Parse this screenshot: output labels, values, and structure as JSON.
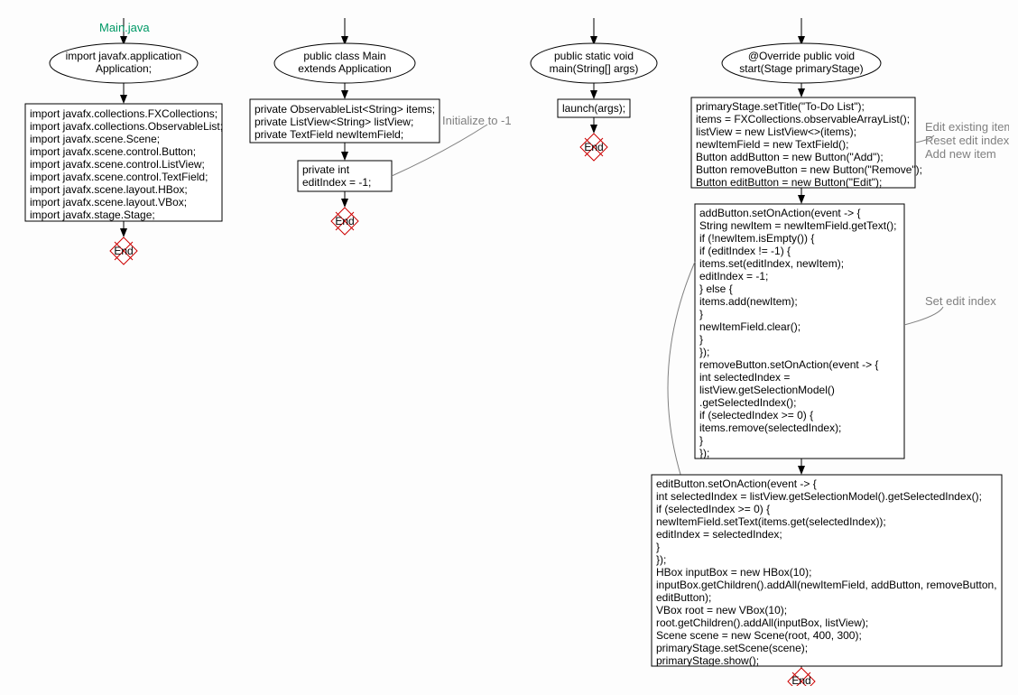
{
  "labels": {
    "main_java": "Main.java",
    "initialize": "Initialize to -1",
    "edit_existing": "Edit existing item",
    "reset_edit": "Reset edit index",
    "add_new": "Add new item",
    "set_edit": "Set edit index"
  },
  "col1": {
    "ellipse": [
      "import javafx.application",
      "Application;"
    ],
    "box": [
      "import javafx.collections.FXCollections;",
      "import javafx.collections.ObservableList;",
      "import javafx.scene.Scene;",
      "import javafx.scene.control.Button;",
      "import javafx.scene.control.ListView;",
      "import javafx.scene.control.TextField;",
      "import javafx.scene.layout.HBox;",
      "import javafx.scene.layout.VBox;",
      "import javafx.stage.Stage;"
    ],
    "end": "End"
  },
  "col2": {
    "ellipse": [
      "public class Main",
      "extends Application"
    ],
    "box1": [
      "private ObservableList<String> items;",
      "private ListView<String> listView;",
      "private TextField newItemField;"
    ],
    "box2": [
      "private int",
      "editIndex = -1;"
    ],
    "end": "End"
  },
  "col3": {
    "ellipse": [
      "public static void",
      "main(String[] args)"
    ],
    "box": [
      "launch(args);"
    ],
    "end": "End"
  },
  "col4": {
    "ellipse": [
      "@Override public void",
      "start(Stage primaryStage)"
    ],
    "box1": [
      "primaryStage.setTitle(\"To-Do List\");",
      "items = FXCollections.observableArrayList();",
      "listView = new ListView<>(items);",
      "newItemField = new TextField();",
      "Button addButton = new Button(\"Add\");",
      "Button removeButton = new Button(\"Remove\");",
      "Button editButton = new Button(\"Edit\");"
    ],
    "box2": [
      "addButton.setOnAction(event -> {",
      " String newItem = newItemField.getText();",
      " if (!newItem.isEmpty()) {",
      "  if (editIndex != -1) {",
      "   items.set(editIndex, newItem);",
      "   editIndex = -1;",
      "  } else {",
      "   items.add(newItem);",
      "  }",
      "  newItemField.clear();",
      " }",
      "});",
      "removeButton.setOnAction(event -> {",
      " int selectedIndex =",
      " listView.getSelectionModel()",
      " .getSelectedIndex();",
      " if (selectedIndex >= 0) {",
      "  items.remove(selectedIndex);",
      " }",
      "});"
    ],
    "box3": [
      "editButton.setOnAction(event -> {",
      " int selectedIndex = listView.getSelectionModel().getSelectedIndex();",
      " if (selectedIndex >= 0) {",
      "  newItemField.setText(items.get(selectedIndex));",
      "  editIndex = selectedIndex;",
      " }",
      "});",
      "HBox inputBox = new HBox(10);",
      "inputBox.getChildren().addAll(newItemField, addButton, removeButton,",
      "editButton);",
      "VBox root = new VBox(10);",
      "root.getChildren().addAll(inputBox, listView);",
      "Scene scene = new Scene(root, 400, 300);",
      "primaryStage.setScene(scene);",
      "primaryStage.show();"
    ],
    "end": "End"
  }
}
